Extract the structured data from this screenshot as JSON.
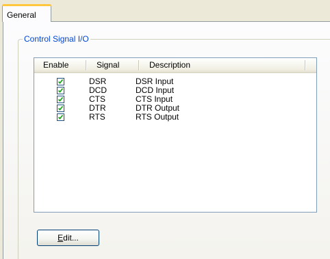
{
  "tabs": [
    {
      "label": "General",
      "selected": true
    }
  ],
  "group": {
    "title": "Control Signal I/O"
  },
  "list": {
    "columns": [
      "Enable",
      "Signal",
      "Description"
    ],
    "rows": [
      {
        "enabled": true,
        "signal": "DSR",
        "description": "DSR Input"
      },
      {
        "enabled": true,
        "signal": "DCD",
        "description": "DCD Input"
      },
      {
        "enabled": true,
        "signal": "CTS",
        "description": "CTS Input"
      },
      {
        "enabled": true,
        "signal": "DTR",
        "description": "DTR Output"
      },
      {
        "enabled": true,
        "signal": "RTS",
        "description": "RTS Output"
      }
    ]
  },
  "buttons": {
    "edit_mnemonic": "E",
    "edit_rest": "dit..."
  }
}
